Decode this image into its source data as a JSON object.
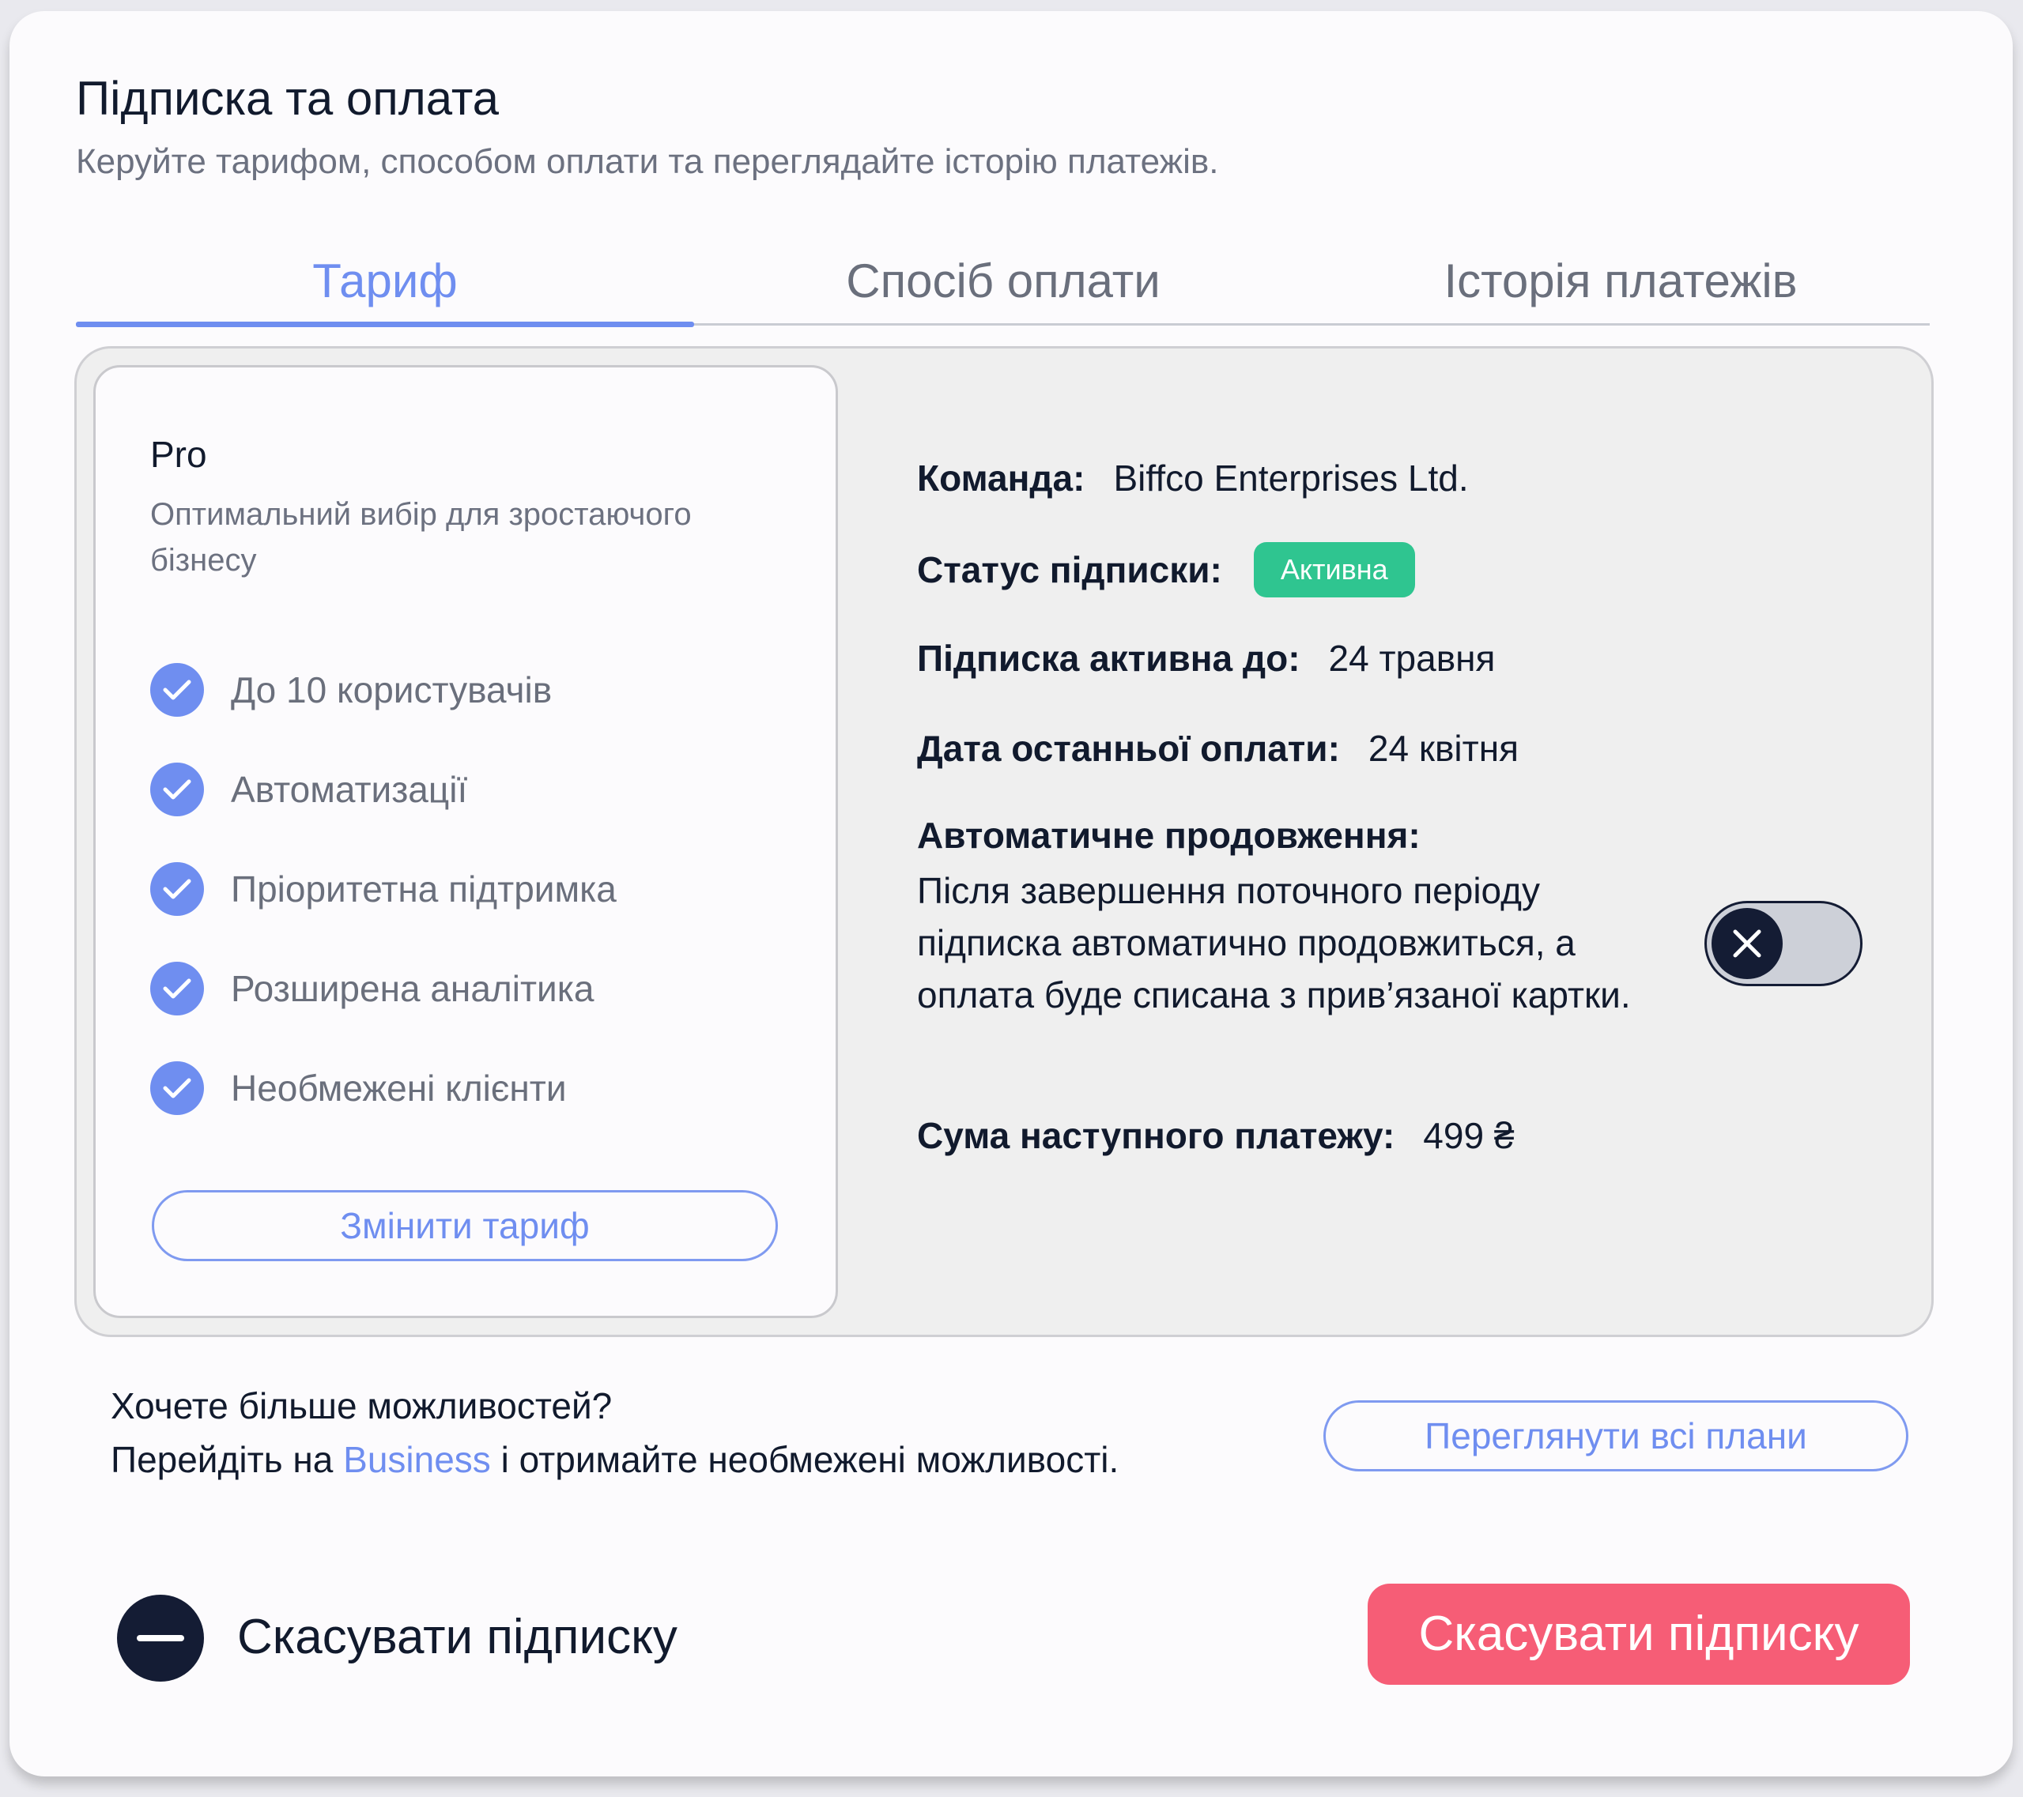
{
  "header": {
    "title": "Підписка та оплата",
    "subtitle": "Керуйте тарифом, способом оплати та переглядайте історію платежів."
  },
  "tabs": [
    {
      "label": "Тариф",
      "active": true
    },
    {
      "label": "Спосіб оплати",
      "active": false
    },
    {
      "label": "Історія платежів",
      "active": false
    }
  ],
  "plan": {
    "name": "Pro",
    "description": "Оптимальний вибір для зростаючого бізнесу",
    "features": [
      "До 10 користувачів",
      "Автоматизації",
      "Пріоритетна підтримка",
      "Розширена аналітика",
      "Необмежені клієнти"
    ],
    "change_label": "Змінити тариф"
  },
  "details": {
    "team_label": "Команда:",
    "team_value": "Biffco Enterprises Ltd.",
    "status_label": "Статус підписки:",
    "status_value": "Активна",
    "active_until_label": "Підписка активна до:",
    "active_until_value": "24 травня",
    "last_payment_label": "Дата останньої оплати:",
    "last_payment_value": "24 квітня",
    "auto_renew_title": "Автоматичне продовження:",
    "auto_renew_desc": "Після завершення поточного періоду підписка автоматично продовжиться, а оплата буде списана з прив’язаної картки.",
    "auto_renew_enabled": false,
    "next_amount_label": "Сума наступного платежу:",
    "next_amount_value": "499 ₴"
  },
  "upsell": {
    "line1": "Хочете більше можливостей?",
    "line2_prefix": "Перейдіть на",
    "line2_link": "Business",
    "line2_suffix": "і отримайте необмежені можливості.",
    "button": "Переглянути всі плани"
  },
  "footer": {
    "cancel_text": "Скасувати підписку",
    "cancel_button": "Скасувати підписку"
  },
  "colors": {
    "accent": "#6f8ef0",
    "success": "#2fc590",
    "danger": "#f65d76",
    "dark": "#141c34"
  },
  "icons": {
    "feature": "check-circle-icon",
    "toggle_off": "close-icon",
    "cancel": "minus-circle-icon"
  }
}
